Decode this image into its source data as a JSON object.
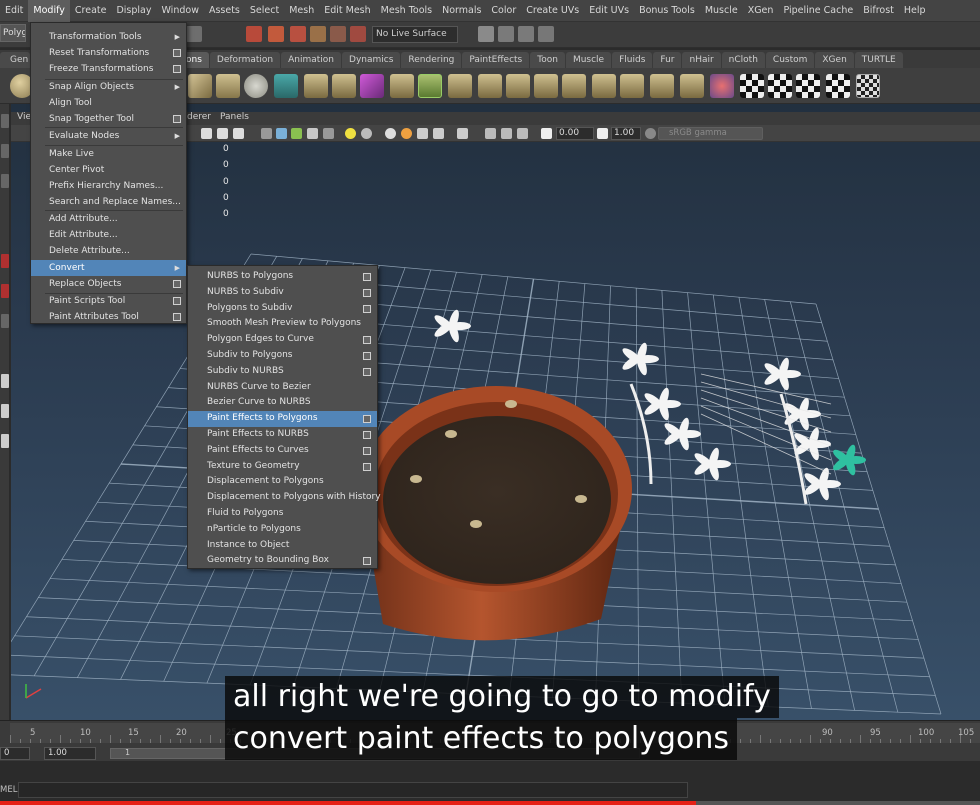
{
  "menubar": {
    "items": [
      "Edit",
      "Modify",
      "Create",
      "Display",
      "Window",
      "Assets",
      "Select",
      "Mesh",
      "Edit Mesh",
      "Mesh Tools",
      "Normals",
      "Color",
      "Create UVs",
      "Edit UVs",
      "Bonus Tools",
      "Muscle",
      "XGen",
      "Pipeline Cache",
      "Bifrost",
      "Help"
    ],
    "active": "Modify"
  },
  "statusline": {
    "mode": "Polygons",
    "live_surface": "No Live Surface"
  },
  "shelf": {
    "tabs": [
      "General",
      "Polygons",
      "Deformation",
      "Animation",
      "Dynamics",
      "Rendering",
      "PaintEffects",
      "Toon",
      "Muscle",
      "Fluids",
      "Fur",
      "nHair",
      "nCloth",
      "Custom",
      "XGen",
      "TURTLE"
    ],
    "visible_first": "Gen",
    "visible_second": "ons"
  },
  "viewport": {
    "menu": {
      "view": "Vie",
      "renderer": "derer",
      "panels": "Panels"
    },
    "exposure": "0.00",
    "gamma": "1.00",
    "color_mgmt": "sRGB gamma",
    "hud_values": [
      "0",
      "0",
      "0",
      "0",
      "0"
    ]
  },
  "modify_menu": {
    "items": [
      {
        "label": "Transformation Tools",
        "kind": "arrow"
      },
      {
        "label": "Reset Transformations",
        "kind": "option"
      },
      {
        "label": "Freeze Transformations",
        "kind": "option"
      },
      {
        "label": "Snap Align Objects",
        "kind": "arrow"
      },
      {
        "label": "Align Tool",
        "kind": "none"
      },
      {
        "label": "Snap Together Tool",
        "kind": "option"
      },
      {
        "label": "Evaluate Nodes",
        "kind": "arrow"
      },
      {
        "label": "Make Live",
        "kind": "none"
      },
      {
        "label": "Center Pivot",
        "kind": "none"
      },
      {
        "label": "Prefix Hierarchy Names...",
        "kind": "none"
      },
      {
        "label": "Search and Replace Names...",
        "kind": "none"
      },
      {
        "label": "Add Attribute...",
        "kind": "none"
      },
      {
        "label": "Edit Attribute...",
        "kind": "none"
      },
      {
        "label": "Delete Attribute...",
        "kind": "none"
      },
      {
        "label": "Convert",
        "kind": "arrow"
      },
      {
        "label": "Replace Objects",
        "kind": "option"
      },
      {
        "label": "Paint Scripts Tool",
        "kind": "option"
      },
      {
        "label": "Paint Attributes Tool",
        "kind": "option"
      }
    ],
    "highlighted": "Convert"
  },
  "convert_menu": {
    "items": [
      {
        "label": "NURBS to Polygons",
        "option": true
      },
      {
        "label": "NURBS to Subdiv",
        "option": true
      },
      {
        "label": "Polygons to Subdiv",
        "option": true
      },
      {
        "label": "Smooth Mesh Preview to Polygons",
        "option": false
      },
      {
        "label": "Polygon Edges to Curve",
        "option": true
      },
      {
        "label": "Subdiv to Polygons",
        "option": true
      },
      {
        "label": "Subdiv to NURBS",
        "option": true
      },
      {
        "label": "NURBS Curve to Bezier",
        "option": false
      },
      {
        "label": "Bezier Curve to NURBS",
        "option": false
      },
      {
        "label": "Paint Effects to Polygons",
        "option": true
      },
      {
        "label": "Paint Effects to NURBS",
        "option": true
      },
      {
        "label": "Paint Effects to Curves",
        "option": true
      },
      {
        "label": "Texture to Geometry",
        "option": true
      },
      {
        "label": "Displacement to Polygons",
        "option": false
      },
      {
        "label": "Displacement to Polygons with History",
        "option": false
      },
      {
        "label": "Fluid to Polygons",
        "option": false
      },
      {
        "label": "nParticle to Polygons",
        "option": false
      },
      {
        "label": "Instance to Object",
        "option": false
      },
      {
        "label": "Geometry to Bounding Box",
        "option": true
      }
    ],
    "highlighted": "Paint Effects to Polygons"
  },
  "timeslider": {
    "ticks": [
      "5",
      "10",
      "15",
      "20",
      "25",
      "90",
      "95",
      "100",
      "105"
    ],
    "start_frame": "0",
    "playback_start": "1.00",
    "range_start": "1"
  },
  "cmdline": {
    "label": "MEL"
  },
  "caption": {
    "line1": "all right we're going to go to modify",
    "line2": "convert paint effects to polygons"
  },
  "video_progress": 0.71,
  "colors": {
    "highlight": "#5285b8",
    "progress": "#e62117",
    "pot": "#b5552e",
    "soil": "#2e241c"
  }
}
